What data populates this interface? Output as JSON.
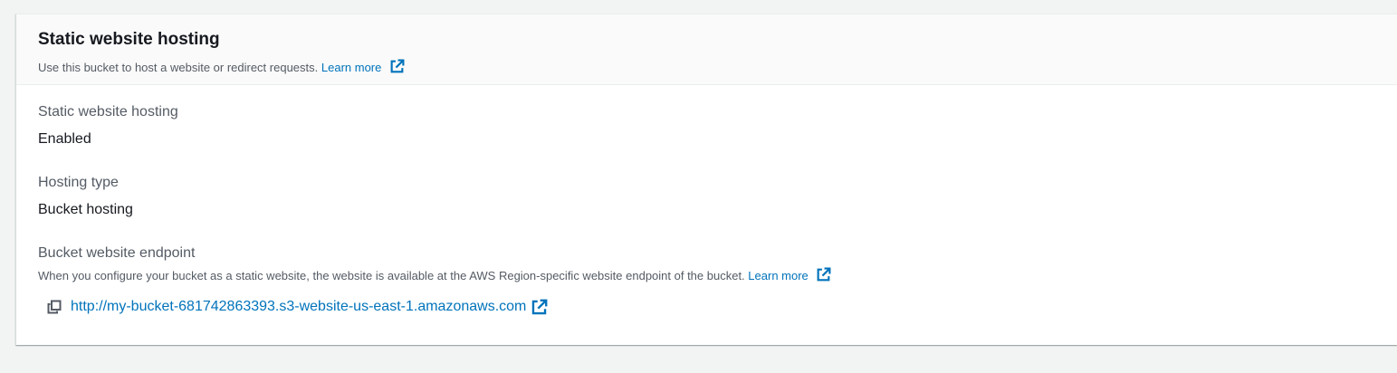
{
  "panel": {
    "title": "Static website hosting",
    "description": "Use this bucket to host a website or redirect requests.",
    "learn_more": "Learn more"
  },
  "fields": {
    "hosting": {
      "label": "Static website hosting",
      "value": "Enabled"
    },
    "hosting_type": {
      "label": "Hosting type",
      "value": "Bucket hosting"
    },
    "endpoint": {
      "label": "Bucket website endpoint",
      "description": "When you configure your bucket as a static website, the website is available at the AWS Region-specific website endpoint of the bucket.",
      "learn_more": "Learn more",
      "url": "http://my-bucket-681742863393.s3-website-us-east-1.amazonaws.com"
    }
  },
  "icons": {
    "external_link": "external-link-icon",
    "copy": "copy-icon"
  },
  "colors": {
    "link": "#0073bb",
    "text": "#16191f",
    "secondary_text": "#545b64",
    "page_background": "#f2f3f3",
    "header_background": "#fafafa"
  }
}
